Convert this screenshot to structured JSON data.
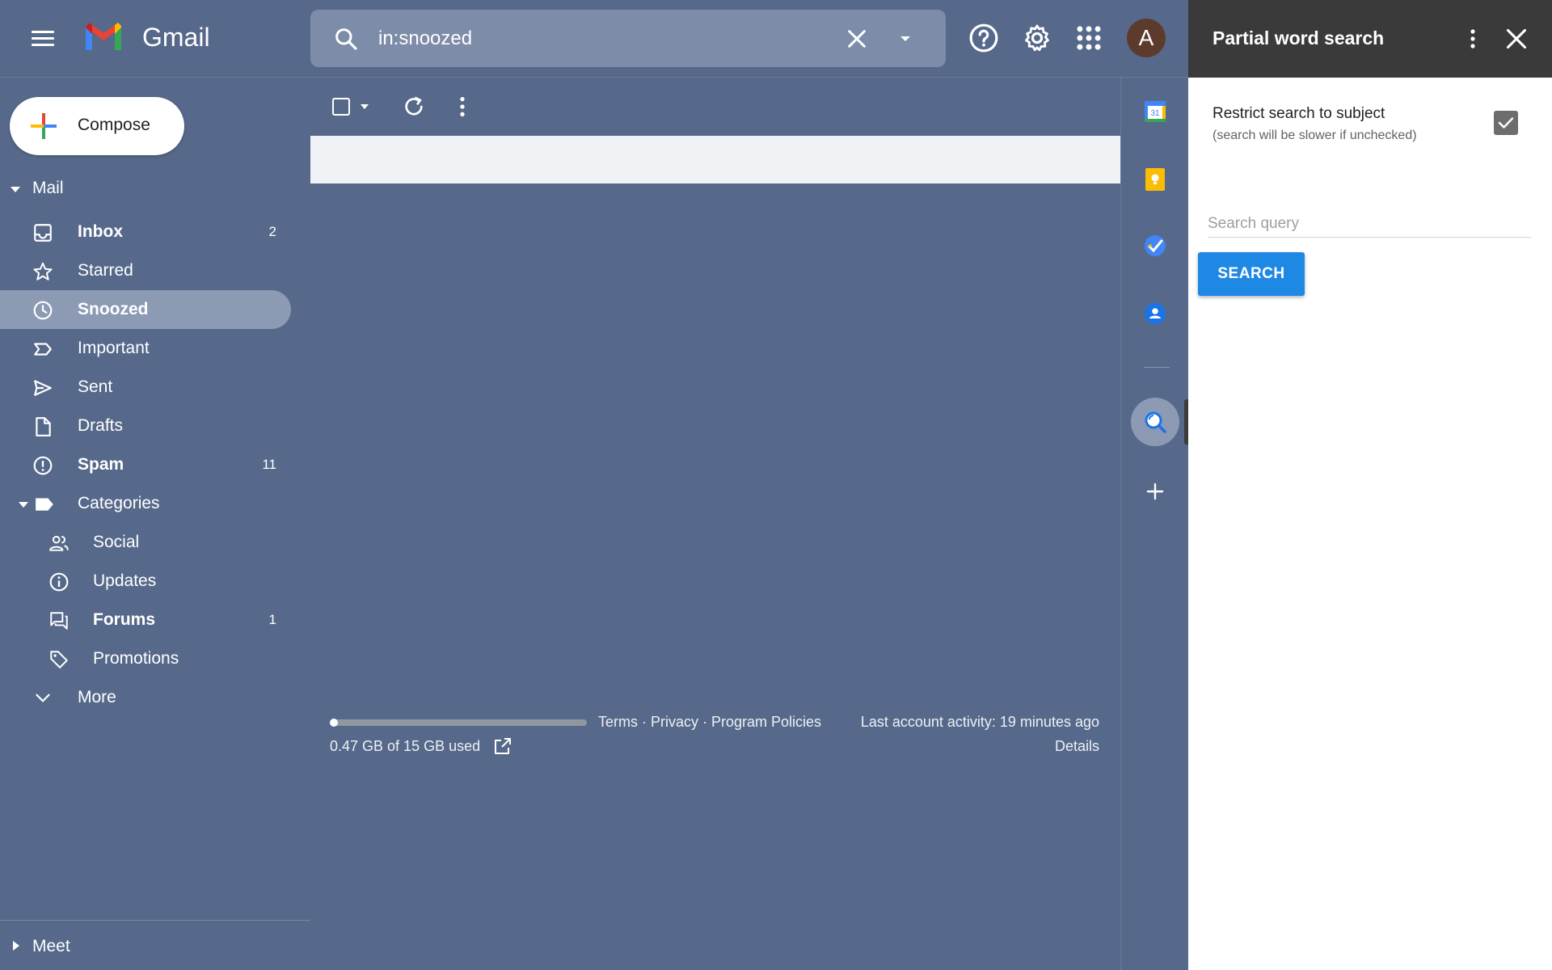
{
  "header": {
    "brand": "Gmail",
    "search_value": "in:snoozed",
    "avatar_letter": "A"
  },
  "compose_label": "Compose",
  "sections": {
    "mail": "Mail",
    "meet": "Meet"
  },
  "nav": {
    "inbox": {
      "label": "Inbox",
      "count": "2"
    },
    "starred": {
      "label": "Starred"
    },
    "snoozed": {
      "label": "Snoozed"
    },
    "important": {
      "label": "Important"
    },
    "sent": {
      "label": "Sent"
    },
    "drafts": {
      "label": "Drafts"
    },
    "spam": {
      "label": "Spam",
      "count": "11"
    },
    "categories": {
      "label": "Categories"
    },
    "social": {
      "label": "Social"
    },
    "updates": {
      "label": "Updates"
    },
    "forums": {
      "label": "Forums",
      "count": "1"
    },
    "promotions": {
      "label": "Promotions"
    },
    "more": {
      "label": "More"
    }
  },
  "footer": {
    "storage_text": "0.47 GB of 15 GB used",
    "storage_fraction": 0.031,
    "terms": "Terms",
    "privacy": "Privacy",
    "policies": "Program Policies",
    "separator": " · ",
    "activity": "Last account activity: 19 minutes ago",
    "details": "Details"
  },
  "rail": {
    "calendar_day": "31"
  },
  "panel": {
    "title": "Partial word search",
    "option_label": "Restrict search to subject",
    "option_help": "(search will be slower if unchecked)",
    "option_checked": true,
    "query_placeholder": "Search query",
    "search_button": "SEARCH"
  },
  "colors": {
    "background": "#56698b",
    "active_nav": "#8c9ab4",
    "panel_header": "#3a3a3a",
    "search_button": "#1e88e5"
  }
}
